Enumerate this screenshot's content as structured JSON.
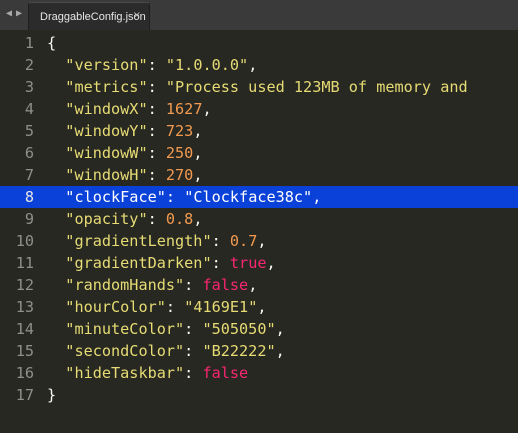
{
  "tab": {
    "title": "DraggableConfig.json",
    "close": "×"
  },
  "nav": {
    "back": "◀",
    "forward": "▶"
  },
  "lines": [
    {
      "num": "1",
      "code": [
        {
          "t": "p",
          "v": "{"
        }
      ]
    },
    {
      "num": "2",
      "code": [
        {
          "t": "g",
          "v": "  "
        },
        {
          "t": "k",
          "v": "\"version\""
        },
        {
          "t": "p",
          "v": ": "
        },
        {
          "t": "s",
          "v": "\"1.0.0.0\""
        },
        {
          "t": "p",
          "v": ","
        }
      ]
    },
    {
      "num": "3",
      "code": [
        {
          "t": "g",
          "v": "  "
        },
        {
          "t": "k",
          "v": "\"metrics\""
        },
        {
          "t": "p",
          "v": ": "
        },
        {
          "t": "s",
          "v": "\"Process used 123MB of memory and"
        }
      ]
    },
    {
      "num": "4",
      "code": [
        {
          "t": "g",
          "v": "  "
        },
        {
          "t": "k",
          "v": "\"windowX\""
        },
        {
          "t": "p",
          "v": ": "
        },
        {
          "t": "n",
          "v": "1627"
        },
        {
          "t": "p",
          "v": ","
        }
      ]
    },
    {
      "num": "5",
      "code": [
        {
          "t": "g",
          "v": "  "
        },
        {
          "t": "k",
          "v": "\"windowY\""
        },
        {
          "t": "p",
          "v": ": "
        },
        {
          "t": "n",
          "v": "723"
        },
        {
          "t": "p",
          "v": ","
        }
      ]
    },
    {
      "num": "6",
      "code": [
        {
          "t": "g",
          "v": "  "
        },
        {
          "t": "k",
          "v": "\"windowW\""
        },
        {
          "t": "p",
          "v": ": "
        },
        {
          "t": "n",
          "v": "250"
        },
        {
          "t": "p",
          "v": ","
        }
      ]
    },
    {
      "num": "7",
      "code": [
        {
          "t": "g",
          "v": "  "
        },
        {
          "t": "k",
          "v": "\"windowH\""
        },
        {
          "t": "p",
          "v": ": "
        },
        {
          "t": "n",
          "v": "270"
        },
        {
          "t": "p",
          "v": ","
        }
      ]
    },
    {
      "num": "8",
      "highlight": true,
      "code": [
        {
          "t": "g",
          "v": "  "
        },
        {
          "t": "k",
          "v": "\"clockFace\""
        },
        {
          "t": "p",
          "v": ": "
        },
        {
          "t": "s",
          "v": "\"Clockface38c\""
        },
        {
          "t": "p",
          "v": ","
        }
      ]
    },
    {
      "num": "9",
      "code": [
        {
          "t": "g",
          "v": "  "
        },
        {
          "t": "k",
          "v": "\"opacity\""
        },
        {
          "t": "p",
          "v": ": "
        },
        {
          "t": "n",
          "v": "0.8"
        },
        {
          "t": "p",
          "v": ","
        }
      ]
    },
    {
      "num": "10",
      "code": [
        {
          "t": "g",
          "v": "  "
        },
        {
          "t": "k",
          "v": "\"gradientLength\""
        },
        {
          "t": "p",
          "v": ": "
        },
        {
          "t": "n",
          "v": "0.7"
        },
        {
          "t": "p",
          "v": ","
        }
      ]
    },
    {
      "num": "11",
      "code": [
        {
          "t": "g",
          "v": "  "
        },
        {
          "t": "k",
          "v": "\"gradientDarken\""
        },
        {
          "t": "p",
          "v": ": "
        },
        {
          "t": "b",
          "v": "true"
        },
        {
          "t": "p",
          "v": ","
        }
      ]
    },
    {
      "num": "12",
      "code": [
        {
          "t": "g",
          "v": "  "
        },
        {
          "t": "k",
          "v": "\"randomHands\""
        },
        {
          "t": "p",
          "v": ": "
        },
        {
          "t": "b",
          "v": "false"
        },
        {
          "t": "p",
          "v": ","
        }
      ]
    },
    {
      "num": "13",
      "code": [
        {
          "t": "g",
          "v": "  "
        },
        {
          "t": "k",
          "v": "\"hourColor\""
        },
        {
          "t": "p",
          "v": ": "
        },
        {
          "t": "s",
          "v": "\"4169E1\""
        },
        {
          "t": "p",
          "v": ","
        }
      ]
    },
    {
      "num": "14",
      "code": [
        {
          "t": "g",
          "v": "  "
        },
        {
          "t": "k",
          "v": "\"minuteColor\""
        },
        {
          "t": "p",
          "v": ": "
        },
        {
          "t": "s",
          "v": "\"505050\""
        },
        {
          "t": "p",
          "v": ","
        }
      ]
    },
    {
      "num": "15",
      "code": [
        {
          "t": "g",
          "v": "  "
        },
        {
          "t": "k",
          "v": "\"secondColor\""
        },
        {
          "t": "p",
          "v": ": "
        },
        {
          "t": "s",
          "v": "\"B22222\""
        },
        {
          "t": "p",
          "v": ","
        }
      ]
    },
    {
      "num": "16",
      "code": [
        {
          "t": "g",
          "v": "  "
        },
        {
          "t": "k",
          "v": "\"hideTaskbar\""
        },
        {
          "t": "p",
          "v": ": "
        },
        {
          "t": "b",
          "v": "false"
        }
      ]
    },
    {
      "num": "17",
      "code": [
        {
          "t": "p",
          "v": "}"
        }
      ]
    }
  ],
  "colors": {
    "editor_bg": "#272822",
    "selection": "#0a41d8",
    "key": "#e6db74",
    "number": "#f29a4f",
    "boolean": "#f92672"
  }
}
